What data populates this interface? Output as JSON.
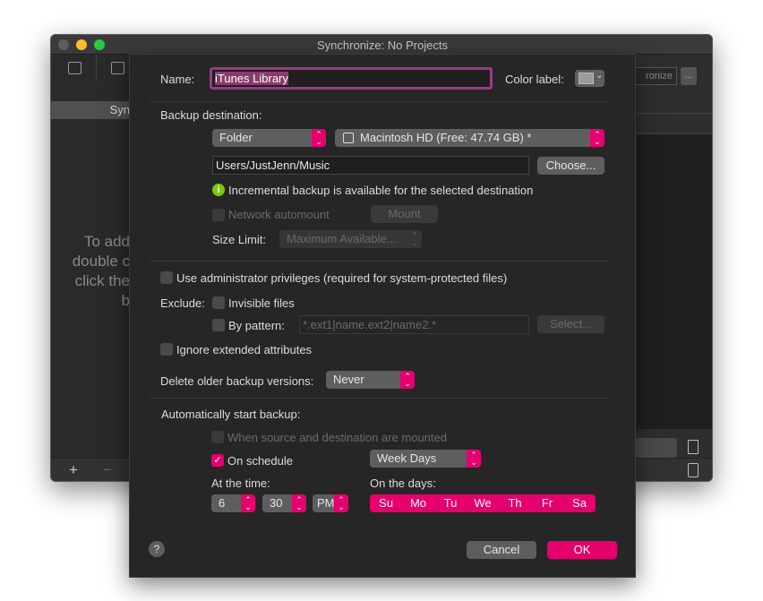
{
  "window": {
    "title": "Synchronize: No Projects",
    "sidebar_selected": "Syn",
    "hint_lines": [
      "To add",
      "double c",
      "click the",
      "b"
    ],
    "right_button": "ronize",
    "more_button": "...",
    "add": "+",
    "remove": "−"
  },
  "sheet": {
    "name_label": "Name:",
    "name_value": "iTunes Library",
    "color_label": "Color label:",
    "backup_destination_label": "Backup destination:",
    "dest_type": "Folder",
    "volume": "Macintosh HD (Free: 47.74 GB) *",
    "path": "Users/JustJenn/Music",
    "choose": "Choose...",
    "info": "Incremental backup is available for the selected destination",
    "network_automount": "Network automount",
    "mount": "Mount",
    "size_limit_label": "Size Limit:",
    "size_limit": "Maximum Available...",
    "admin": "Use administrator privileges (required for system-protected files)",
    "exclude_label": "Exclude:",
    "invisible": "Invisible files",
    "by_pattern": "By pattern:",
    "pattern_placeholder": "*.ext1|name.ext2|name2.*",
    "select": "Select...",
    "ignore_attrs": "Ignore extended attributes",
    "delete_label": "Delete older backup versions:",
    "delete_value": "Never",
    "auto_label": "Automatically start backup:",
    "when_mounted": "When source and destination are mounted",
    "on_schedule": "On schedule",
    "on_schedule_checked": true,
    "schedule": "Week Days",
    "time_label": "At the time:",
    "hour": "6",
    "minute": "30",
    "ampm": "PM",
    "days_label": "On the days:",
    "days": [
      "Su",
      "Mo",
      "Tu",
      "We",
      "Th",
      "Fr",
      "Sa"
    ],
    "help": "?",
    "cancel": "Cancel",
    "ok": "OK"
  },
  "colors": {
    "accent": "#e5006e",
    "info": "#7ac70c"
  }
}
